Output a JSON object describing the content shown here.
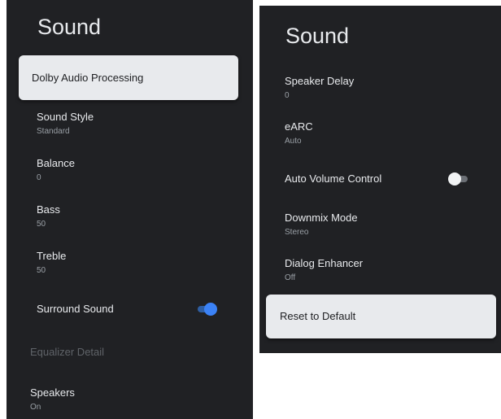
{
  "left_panel": {
    "title": "Sound",
    "dolby": {
      "label": "Dolby Audio Processing"
    },
    "sound_style": {
      "label": "Sound Style",
      "value": "Standard"
    },
    "balance": {
      "label": "Balance",
      "value": "0"
    },
    "bass": {
      "label": "Bass",
      "value": "50"
    },
    "treble": {
      "label": "Treble",
      "value": "50"
    },
    "surround": {
      "label": "Surround Sound",
      "enabled": true
    },
    "equalizer_header": "Equalizer Detail",
    "speakers": {
      "label": "Speakers",
      "value": "On"
    }
  },
  "right_panel": {
    "title": "Sound",
    "speaker_delay": {
      "label": "Speaker Delay",
      "value": "0"
    },
    "earc": {
      "label": "eARC",
      "value": "Auto"
    },
    "auto_volume": {
      "label": "Auto Volume Control",
      "enabled": false
    },
    "downmix": {
      "label": "Downmix Mode",
      "value": "Stereo"
    },
    "dialog_enhancer": {
      "label": "Dialog Enhancer",
      "value": "Off"
    },
    "reset": {
      "label": "Reset to Default"
    }
  },
  "colors": {
    "panel_bg": "#202124",
    "focus_card": "#e8eaed",
    "toggle_on": "#3b82f6",
    "text_primary": "#e8eaed",
    "text_secondary": "#9aa0a6"
  }
}
